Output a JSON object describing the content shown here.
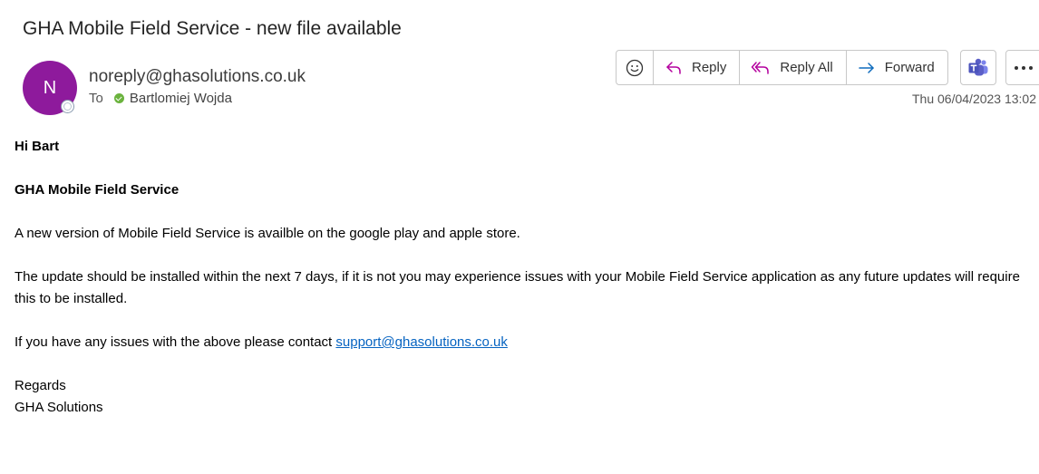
{
  "email": {
    "subject": "GHA Mobile Field Service - new file available",
    "sender_initial": "N",
    "sender": "noreply@ghasolutions.co.uk",
    "to_label": "To",
    "recipient": "Bartlomiej Wojda",
    "date": "Thu 06/04/2023 13:02"
  },
  "toolbar": {
    "emoji_icon": "smiley-icon",
    "reply_label": "Reply",
    "reply_all_label": "Reply All",
    "forward_label": "Forward",
    "teams_icon": "teams-icon",
    "more_icon": "more-icon"
  },
  "body": {
    "greeting": "Hi Bart",
    "heading": "GHA Mobile Field Service",
    "para1": "A new version of Mobile Field Service is availble on the google play and apple store.",
    "para2": "The update should be installed within the next 7 days, if it is not you may experience issues with your Mobile Field Service application as any future updates will require this to be installed.",
    "para3_prefix": "If you have any issues with the above please contact ",
    "support_link": "support@ghasolutions.co.uk",
    "regards": "Regards",
    "signature": "GHA Solutions"
  },
  "colors": {
    "avatar": "#8e1a9c",
    "reply_icon": "#b4009e",
    "forward_icon": "#0f6cbd",
    "teams": "#5b5fc7",
    "link": "#0563c1"
  }
}
